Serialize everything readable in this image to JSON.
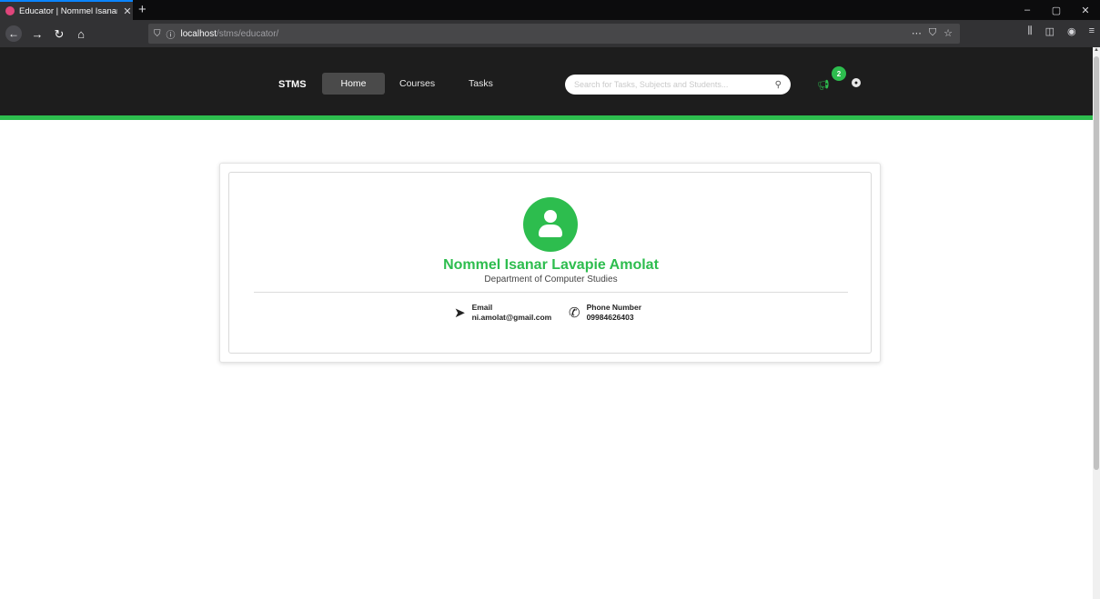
{
  "browser": {
    "tab_title": "Educator | Nommel Isanar Lavapie Amolat",
    "url_host": "localhost",
    "url_path": "/stms/educator/",
    "window_controls": [
      "–",
      "▢",
      "✕"
    ]
  },
  "header": {
    "brand": "STMS",
    "nav": {
      "home": "Home",
      "courses": "Courses",
      "tasks": "Tasks"
    },
    "search_placeholder": "Search for Tasks, Subjects and Students...",
    "notification_count": "2",
    "accent_color": "#2dbd4e"
  },
  "profile": {
    "name": "Nommel Isanar Lavapie Amolat",
    "department": "Department of Computer Studies",
    "email_label": "Email",
    "email_value": "ni.amolat@gmail.com",
    "phone_label": "Phone Number",
    "phone_value": "09984626403"
  }
}
